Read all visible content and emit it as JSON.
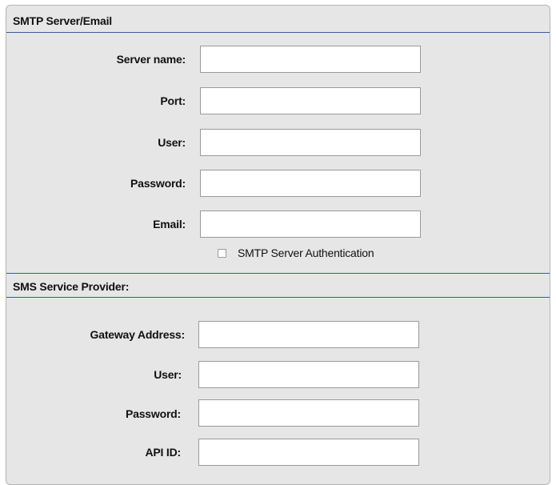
{
  "smtp": {
    "title": "SMTP Server/Email",
    "fields": [
      {
        "label": "Server name:",
        "value": ""
      },
      {
        "label": "Port:",
        "value": ""
      },
      {
        "label": "User:",
        "value": ""
      },
      {
        "label": "Password:",
        "value": ""
      },
      {
        "label": "Email:",
        "value": ""
      }
    ],
    "auth_checkbox": {
      "label": "SMTP Server Authentication",
      "checked": false
    }
  },
  "sms": {
    "title": "SMS Service Provider:",
    "fields": [
      {
        "label": "Gateway Address:",
        "value": ""
      },
      {
        "label": "User:",
        "value": ""
      },
      {
        "label": "Password:",
        "value": ""
      },
      {
        "label": "API ID:",
        "value": ""
      }
    ]
  }
}
